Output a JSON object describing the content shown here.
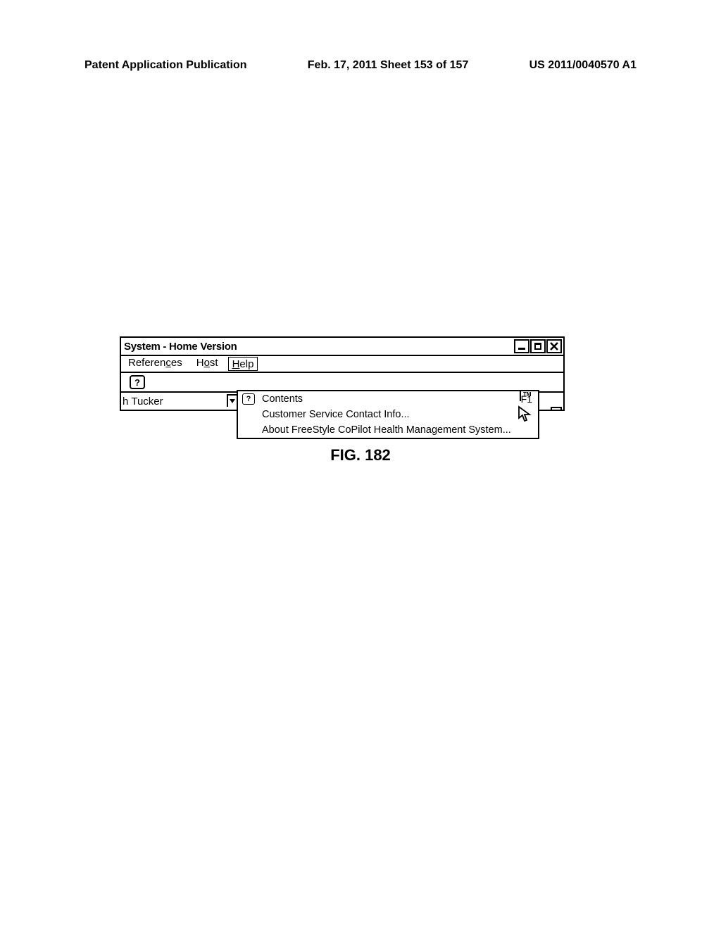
{
  "page_header": {
    "left": "Patent Application Publication",
    "center": "Feb. 17, 2011  Sheet 153 of 157",
    "right": "US 2011/0040570 A1"
  },
  "window": {
    "title": "System - Home Version",
    "menubar": {
      "references": "References",
      "references_u": "c",
      "host": "Host",
      "host_u": "o",
      "help": "Help",
      "help_u": "H"
    },
    "toolbar": {
      "help_icon": "?"
    },
    "content": {
      "user": "Tucker",
      "user_prefix": "h"
    },
    "help_menu": {
      "icon": "?",
      "contents": "Contents",
      "shortcut": "F1",
      "customer_service": "Customer Service Contact Info...",
      "about": "About FreeStyle CoPilot Health Management System...",
      "tm": "TM"
    }
  },
  "figure_label": "FIG. 182"
}
